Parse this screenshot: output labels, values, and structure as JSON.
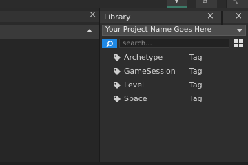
{
  "colors": {
    "accent": "#1e88e5",
    "panel": "#2e2e2e",
    "header": "#3a3a3a"
  },
  "left_panel": {
    "close_glyph": "×"
  },
  "library": {
    "title": "Library",
    "close_glyph": "×",
    "project": {
      "selected": "Your Project Name Goes Here"
    },
    "search": {
      "placeholder": "search...",
      "icon": "search-icon"
    },
    "view_icon": "grid-view-icon",
    "items": [
      {
        "name": "Archetype",
        "type": "Tag",
        "icon": "tag-icon"
      },
      {
        "name": "GameSession",
        "type": "Tag",
        "icon": "tag-icon"
      },
      {
        "name": "Level",
        "type": "Tag",
        "icon": "tag-icon"
      },
      {
        "name": "Space",
        "type": "Tag",
        "icon": "tag-icon"
      }
    ]
  }
}
